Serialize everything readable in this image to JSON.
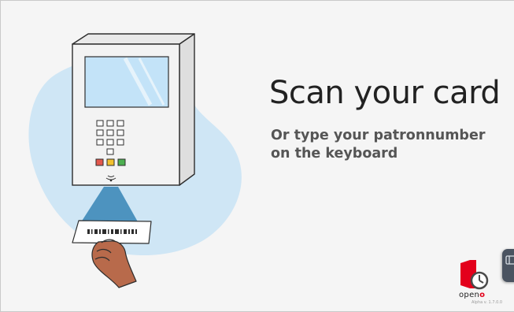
{
  "prompt": {
    "title": "Scan your card",
    "subtitle": "Or type your patronnumber on the keyboard"
  },
  "illustration": {
    "semantic": "card-scanner-with-hand",
    "colors": {
      "blob": "#cfe6f5",
      "body": "#f3f3f3",
      "outline": "#2d2d2d",
      "screen": "#c3e3f8",
      "beam": "#3e89b9",
      "led_red": "#e2574c",
      "led_yellow": "#f2c12e",
      "led_green": "#4caf50",
      "skin": "#b86a4b"
    }
  },
  "branding": {
    "logo_icon": "door-clock-icon",
    "name": "open",
    "name_accent": "o",
    "version": "Alpha v. 1.7.0.0",
    "brand_color": "#e3001b"
  },
  "side_tab": {
    "icon": "panel-toggle-icon",
    "color": "#4a5360"
  }
}
